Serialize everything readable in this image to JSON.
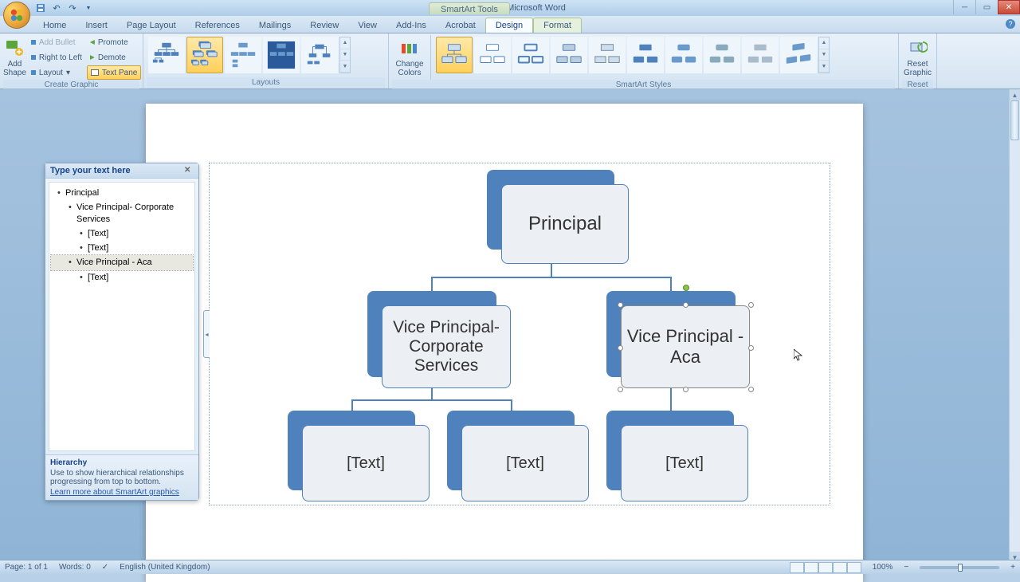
{
  "title": "Document5 - Microsoft Word",
  "smartart_tools_label": "SmartArt Tools",
  "tabs": {
    "home": "Home",
    "insert": "Insert",
    "page_layout": "Page Layout",
    "references": "References",
    "mailings": "Mailings",
    "review": "Review",
    "view": "View",
    "addins": "Add-Ins",
    "acrobat": "Acrobat",
    "design": "Design",
    "format": "Format"
  },
  "ribbon": {
    "add_shape": "Add\nShape",
    "add_bullet": "Add Bullet",
    "right_to_left": "Right to Left",
    "layout": "Layout",
    "promote": "Promote",
    "demote": "Demote",
    "text_pane": "Text Pane",
    "create_graphic": "Create Graphic",
    "layouts": "Layouts",
    "change_colors": "Change\nColors",
    "smartart_styles": "SmartArt Styles",
    "reset_graphic": "Reset\nGraphic",
    "reset": "Reset"
  },
  "text_pane": {
    "title": "Type your text here",
    "items": [
      {
        "level": 1,
        "text": "Principal"
      },
      {
        "level": 2,
        "text": "Vice Principal- Corporate Services"
      },
      {
        "level": 3,
        "text": "[Text]"
      },
      {
        "level": 3,
        "text": "[Text]"
      },
      {
        "level": 2,
        "text": "Vice Principal -  Aca",
        "selected": true
      },
      {
        "level": 3,
        "text": "[Text]"
      }
    ],
    "footer_title": "Hierarchy",
    "footer_desc": "Use to show hierarchical relationships progressing from top to bottom.",
    "footer_link": "Learn more about SmartArt graphics"
  },
  "org": {
    "principal": "Principal",
    "vp_corp": "Vice Principal- Corporate Services",
    "vp_aca": "Vice Principal -  Aca",
    "placeholder": "[Text]"
  },
  "status": {
    "page": "Page: 1 of 1",
    "words": "Words: 0",
    "language": "English (United Kingdom)",
    "zoom": "100%"
  }
}
